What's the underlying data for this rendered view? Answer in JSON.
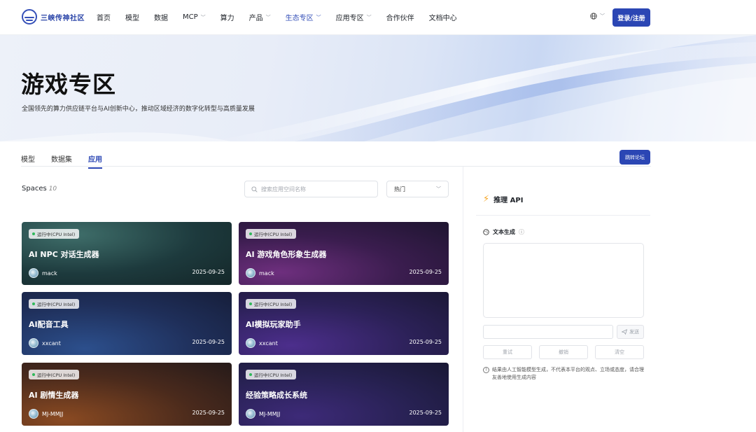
{
  "brand": {
    "name": "三峡传神社区"
  },
  "nav": {
    "items": [
      {
        "label": "首页",
        "dropdown": false,
        "active": false
      },
      {
        "label": "模型",
        "dropdown": false,
        "active": false
      },
      {
        "label": "数据",
        "dropdown": false,
        "active": false
      },
      {
        "label": "MCP",
        "dropdown": true,
        "active": false
      },
      {
        "label": "算力",
        "dropdown": false,
        "active": false
      },
      {
        "label": "产品",
        "dropdown": true,
        "active": false
      },
      {
        "label": "生态专区",
        "dropdown": true,
        "active": true
      },
      {
        "label": "应用专区",
        "dropdown": true,
        "active": false
      },
      {
        "label": "合作伙伴",
        "dropdown": false,
        "active": false
      },
      {
        "label": "文档中心",
        "dropdown": false,
        "active": false
      }
    ],
    "login_label": "登录/注册",
    "language_icon": "globe-icon"
  },
  "hero": {
    "title": "游戏专区",
    "subtitle": "全国领先的算力供应链平台与AI创新中心，推动区域经济的数字化转型与高质量发展"
  },
  "tabs": {
    "items": [
      "模型",
      "数据集",
      "应用"
    ],
    "active": "应用",
    "forum_label": "跳转论坛"
  },
  "spaces": {
    "title": "Spaces",
    "count": "10",
    "search_placeholder": "搜索应用空间名称",
    "sort_value": "热门",
    "cards": [
      {
        "status": "运行中(CPU Intel)",
        "title": "AI NPC 对话生成器",
        "author": "mack",
        "date": "2025-09-25",
        "theme": "teal"
      },
      {
        "status": "运行中(CPU Intel)",
        "title": "AI 游戏角色形象生成器",
        "author": "mack",
        "date": "2025-09-25",
        "theme": "purple"
      },
      {
        "status": "运行中(CPU Intel)",
        "title": "AI配音工具",
        "author": "xxcant",
        "date": "2025-09-25",
        "theme": "blue"
      },
      {
        "status": "运行中(CPU Intel)",
        "title": "AI模拟玩家助手",
        "author": "xxcant",
        "date": "2025-09-25",
        "theme": "violet"
      },
      {
        "status": "运行中(CPU Intel)",
        "title": "AI 剧情生成器",
        "author": "MJ-MMJJ",
        "date": "2025-09-25",
        "theme": "brown"
      },
      {
        "status": "运行中(CPU Intel)",
        "title": "经验策略成长系统",
        "author": "MJ-MMJJ",
        "date": "2025-09-25",
        "theme": "indigo"
      }
    ]
  },
  "api_panel": {
    "title": "推理 API",
    "section_title": "文本生成",
    "send_label": "发送",
    "actions": [
      "重试",
      "撤销",
      "清空"
    ],
    "disclaimer": "结果由人工智能模型生成，不代表本平台的观点、立场或态度，请合理友善地使用生成内容"
  },
  "colors": {
    "accent": "#2b46b4",
    "status_dot": "#2fb85a",
    "bolt": "#f5a524"
  }
}
